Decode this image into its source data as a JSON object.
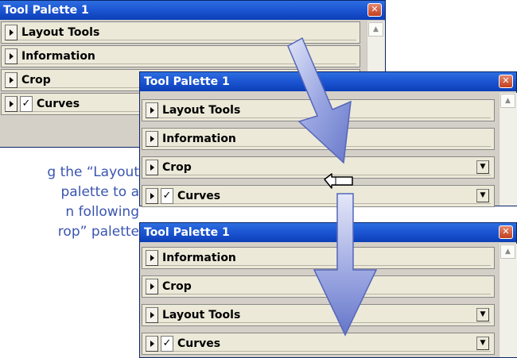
{
  "palettes": [
    {
      "title": "Tool Palette 1",
      "close_glyph": "✕",
      "rows": [
        {
          "label": "Layout Tools",
          "checked": false,
          "has_dropdown": false
        },
        {
          "label": "Information",
          "checked": false,
          "has_dropdown": false
        },
        {
          "label": "Crop",
          "checked": false,
          "has_dropdown": false
        },
        {
          "label": "Curves",
          "checked": true,
          "has_dropdown": false
        }
      ]
    },
    {
      "title": "Tool Palette 1",
      "close_glyph": "✕",
      "rows": [
        {
          "label": "Layout Tools",
          "checked": false,
          "has_dropdown": false
        },
        {
          "label": "Information",
          "checked": false,
          "has_dropdown": false
        },
        {
          "label": "Crop",
          "checked": false,
          "has_dropdown": true
        },
        {
          "label": "Curves",
          "checked": true,
          "has_dropdown": true
        }
      ]
    },
    {
      "title": "Tool Palette 1",
      "close_glyph": "✕",
      "rows": [
        {
          "label": "Information",
          "checked": false,
          "has_dropdown": false
        },
        {
          "label": "Crop",
          "checked": false,
          "has_dropdown": false
        },
        {
          "label": "Layout Tools",
          "checked": false,
          "has_dropdown": true
        },
        {
          "label": "Curves",
          "checked": true,
          "has_dropdown": true
        }
      ]
    }
  ],
  "caption_lines": [
    "g the “Layout",
    "palette to a",
    "n following",
    "rop” palette"
  ],
  "glyphs": {
    "checkmark": "✓",
    "dropdown": "▼",
    "scroll_up": "▲",
    "drag_cursor": "drag-hand-cursor-icon"
  },
  "colors": {
    "titlebar": "#1d56d3",
    "caption": "#3a55b0",
    "arrow": "#8494d8",
    "panel": "#ece9d8"
  }
}
